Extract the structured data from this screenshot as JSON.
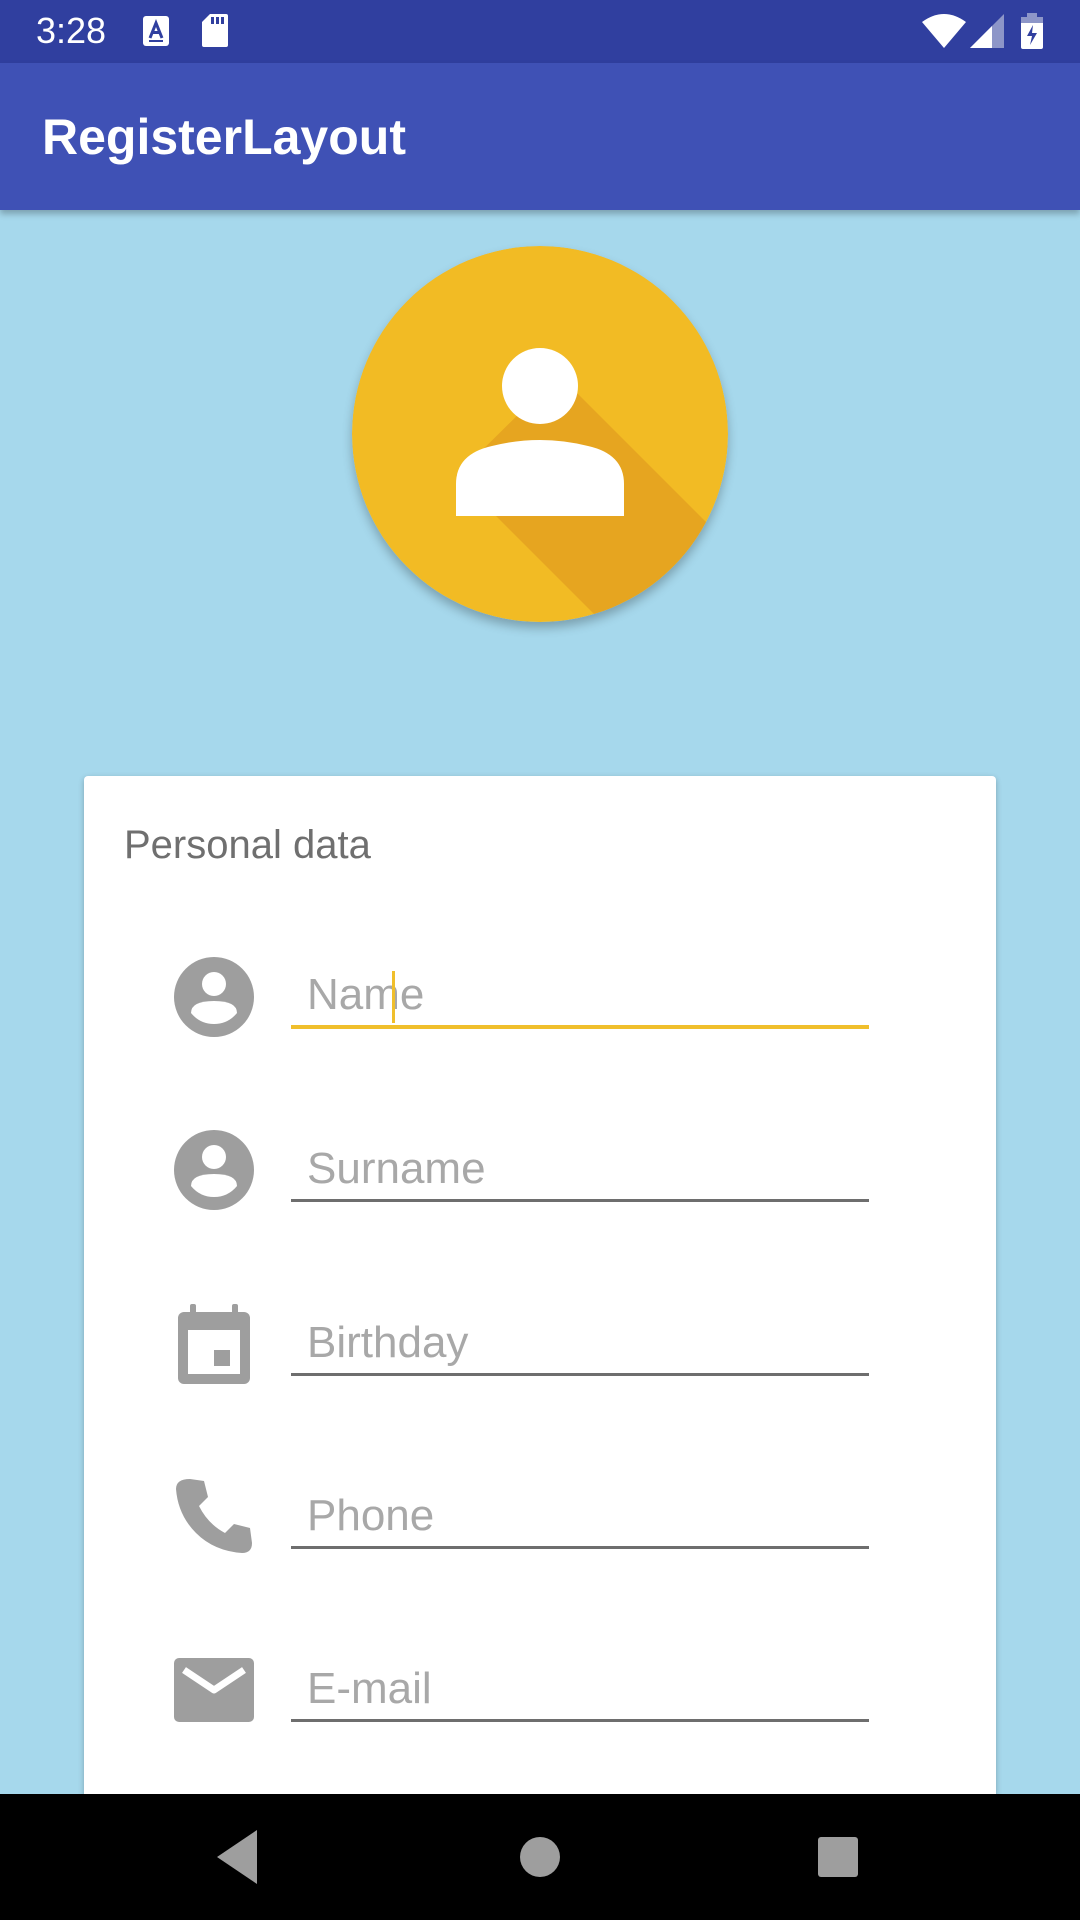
{
  "status_bar": {
    "time": "3:28",
    "icons": [
      "keyboard-a-icon",
      "sd-card-icon",
      "wifi-icon",
      "cell-signal-icon",
      "battery-charging-icon"
    ],
    "background": "#303f9f"
  },
  "app_bar": {
    "title": "RegisterLayout",
    "background": "#3f51b5"
  },
  "avatar": {
    "icon": "person-icon",
    "background": "#f2bb24"
  },
  "form": {
    "title": "Personal data",
    "fields": [
      {
        "icon": "account-circle-icon",
        "placeholder": "Name",
        "value": "",
        "focused": true
      },
      {
        "icon": "account-circle-icon",
        "placeholder": "Surname",
        "value": ""
      },
      {
        "icon": "calendar-icon",
        "placeholder": "Birthday",
        "value": ""
      },
      {
        "icon": "phone-icon",
        "placeholder": "Phone",
        "value": ""
      },
      {
        "icon": "email-icon",
        "placeholder": "E-mail",
        "value": ""
      }
    ]
  },
  "colors": {
    "page_background": "#a6d8ec",
    "accent": "#f0bf2c",
    "icon_gray": "#9e9e9e"
  },
  "nav_bar": {
    "buttons": [
      "back-icon",
      "home-icon",
      "recents-icon"
    ]
  }
}
